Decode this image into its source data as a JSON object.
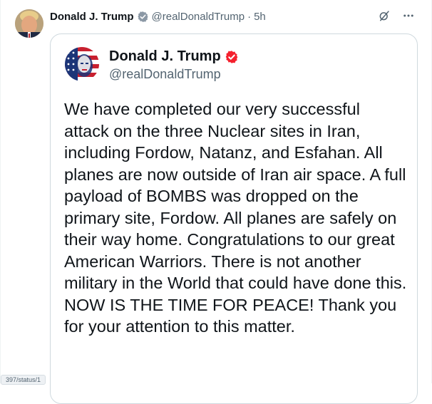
{
  "post": {
    "author_name": "Donald J. Trump",
    "author_handle": "@realDonaldTrump",
    "separator": "·",
    "time": "5h"
  },
  "quoted": {
    "author_name": "Donald J. Trump",
    "author_handle": "@realDonaldTrump",
    "text": "We have completed our very successful attack on the three Nuclear sites in Iran, including Fordow, Natanz, and Esfahan. All planes are now outside of Iran air space. A full payload of BOMBS was dropped on the primary site, Fordow. All planes are safely on their way home. Congratulations to our great American Warriors. There is not another military in the World that could have done this. NOW IS THE TIME FOR PEACE! Thank you for your attention to this matter."
  },
  "status_chip": "397/status/1",
  "colors": {
    "verified": "#8b98a5",
    "quoted_verified": "#f4212e",
    "secondary_text": "#536471",
    "border": "#cfd9de"
  },
  "icons": {
    "grok": "grok-icon",
    "more": "more-icon",
    "verified": "verified-badge-icon"
  }
}
